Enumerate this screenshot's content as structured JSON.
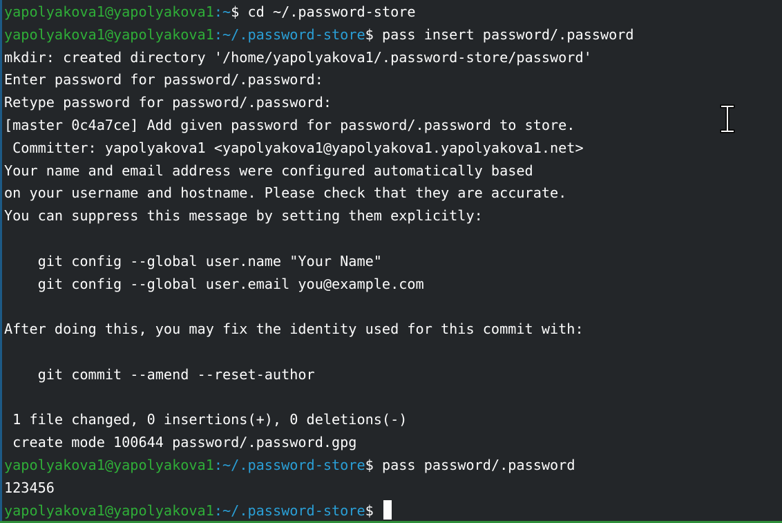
{
  "colors": {
    "background": "#232629",
    "text": "#fcfcfc",
    "prompt_user": "#2fae38",
    "prompt_path": "#2a9fd6"
  },
  "prompt": {
    "user_host": "yapolyakova1@yapolyakova1",
    "colon": ":"
  },
  "lines": [
    {
      "type": "prompt",
      "path": "~",
      "sigil": "$ ",
      "command": "cd ~/.password-store"
    },
    {
      "type": "prompt",
      "path": "~/.password-store",
      "sigil": "$ ",
      "command": "pass insert password/.password"
    },
    {
      "type": "text",
      "text": "mkdir: created directory '/home/yapolyakova1/.password-store/password'"
    },
    {
      "type": "text",
      "text": "Enter password for password/.password:"
    },
    {
      "type": "text",
      "text": "Retype password for password/.password:"
    },
    {
      "type": "text",
      "text": "[master 0c4a7ce] Add given password for password/.password to store."
    },
    {
      "type": "text",
      "text": " Committer: yapolyakova1 <yapolyakova1@yapolyakova1.yapolyakova1.net>"
    },
    {
      "type": "text",
      "text": "Your name and email address were configured automatically based"
    },
    {
      "type": "text",
      "text": "on your username and hostname. Please check that they are accurate."
    },
    {
      "type": "text",
      "text": "You can suppress this message by setting them explicitly:"
    },
    {
      "type": "text",
      "text": ""
    },
    {
      "type": "text",
      "text": "    git config --global user.name \"Your Name\""
    },
    {
      "type": "text",
      "text": "    git config --global user.email you@example.com"
    },
    {
      "type": "text",
      "text": ""
    },
    {
      "type": "text",
      "text": "After doing this, you may fix the identity used for this commit with:"
    },
    {
      "type": "text",
      "text": ""
    },
    {
      "type": "text",
      "text": "    git commit --amend --reset-author"
    },
    {
      "type": "text",
      "text": ""
    },
    {
      "type": "text",
      "text": " 1 file changed, 0 insertions(+), 0 deletions(-)"
    },
    {
      "type": "text",
      "text": " create mode 100644 password/.password.gpg"
    },
    {
      "type": "prompt",
      "path": "~/.password-store",
      "sigil": "$ ",
      "command": "pass password/.password"
    },
    {
      "type": "text",
      "text": "123456"
    },
    {
      "type": "prompt",
      "path": "~/.password-store",
      "sigil": "$ ",
      "command": "",
      "cursor": true
    }
  ],
  "icons": {
    "text_cursor": "ibeam-cursor-icon",
    "terminal_cursor": "block-cursor-icon"
  }
}
